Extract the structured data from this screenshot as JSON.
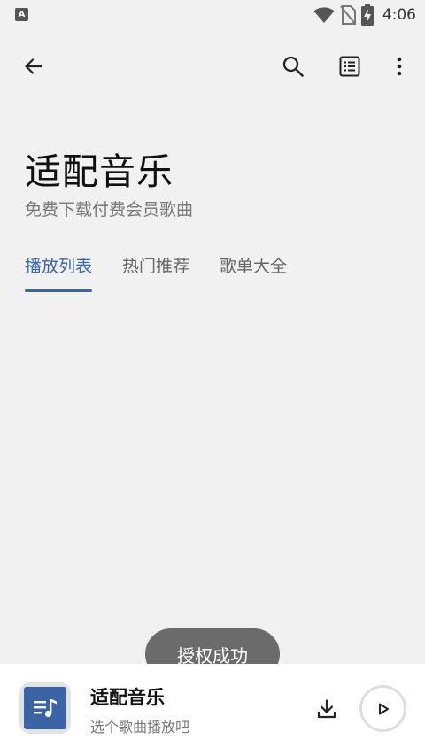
{
  "status_bar": {
    "notification_icon": "A",
    "time": "4:06",
    "icons": [
      "wifi-icon",
      "no-sim-icon",
      "battery-charging-icon"
    ]
  },
  "appbar": {
    "icons": [
      "back-arrow-icon",
      "search-icon",
      "list-icon",
      "more-vert-icon"
    ]
  },
  "header": {
    "title": "适配音乐",
    "subtitle": "免费下载付费会员歌曲"
  },
  "tabs": [
    {
      "label": "播放列表",
      "active": true
    },
    {
      "label": "热门推荐",
      "active": false
    },
    {
      "label": "歌单大全",
      "active": false
    }
  ],
  "toast": {
    "text": "授权成功"
  },
  "player": {
    "title": "适配音乐",
    "subtitle": "选个歌曲播放吧",
    "icons": [
      "music-note-icon",
      "download-icon",
      "play-icon"
    ]
  },
  "colors": {
    "accent": "#3a64a6",
    "background": "#f1f1f1",
    "toast_bg": "#6b6b6b"
  }
}
